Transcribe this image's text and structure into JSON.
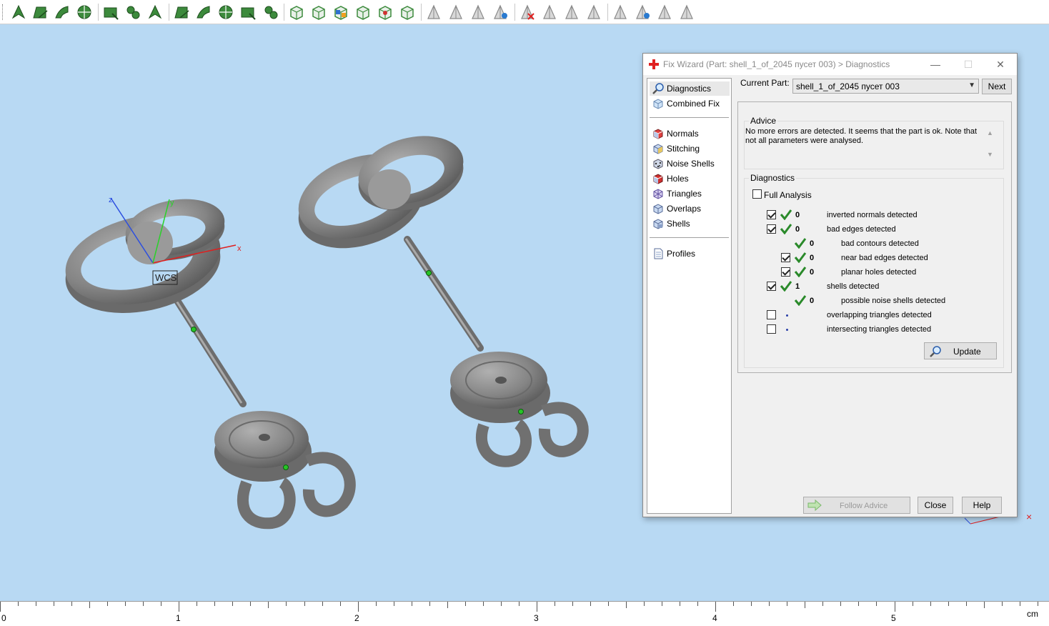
{
  "toolbar": {
    "tools": [
      {
        "name": "select-triangle-icon"
      },
      {
        "name": "select-area-icon"
      },
      {
        "name": "select-curve-icon"
      },
      {
        "name": "select-circle-icon"
      },
      {
        "name": "select-rect-icon"
      },
      {
        "name": "select-shell-icon"
      },
      {
        "name": "select-path-icon"
      },
      {
        "name": "select-plane-icon"
      },
      {
        "name": "select-edge-icon"
      },
      {
        "name": "select-multi-icon"
      },
      {
        "name": "select-wheel-icon"
      },
      {
        "name": "select-surface-icon"
      },
      {
        "name": "box-view-1-icon"
      },
      {
        "name": "box-view-2-icon"
      },
      {
        "name": "box-view-3-icon"
      },
      {
        "name": "box-view-4-icon"
      },
      {
        "name": "box-view-5-icon"
      },
      {
        "name": "box-view-6-icon"
      },
      {
        "name": "triangle-mark-1-icon"
      },
      {
        "name": "triangle-mark-2-icon"
      },
      {
        "name": "triangle-mark-3-icon"
      },
      {
        "name": "triangle-mark-4-icon"
      },
      {
        "name": "triangle-unmark-icon"
      },
      {
        "name": "triangle-mark-5-icon"
      },
      {
        "name": "triangle-mark-6-icon"
      },
      {
        "name": "triangle-mark-7-icon"
      },
      {
        "name": "shell-mark-1-icon"
      },
      {
        "name": "shell-mark-2-icon"
      },
      {
        "name": "shell-mark-3-icon"
      },
      {
        "name": "shell-mark-4-icon"
      }
    ]
  },
  "viewport": {
    "wcs_label": "WCS",
    "axis_x": "x",
    "axis_y": "y",
    "axis_z": "z",
    "close_mark": "×"
  },
  "ruler": {
    "labels": [
      "0",
      "1",
      "2",
      "3",
      "4",
      "5"
    ],
    "unit": "cm"
  },
  "dialog": {
    "title": "Fix Wizard (Part: shell_1_of_2045 пусет 003) > Diagnostics",
    "minimize": "—",
    "maximize": "☐",
    "close": "✕",
    "nav": {
      "diagnostics": "Diagnostics",
      "combined_fix": "Combined Fix",
      "normals": "Normals",
      "stitching": "Stitching",
      "noise_shells": "Noise Shells",
      "holes": "Holes",
      "triangles": "Triangles",
      "overlaps": "Overlaps",
      "shells": "Shells",
      "profiles": "Profiles"
    },
    "current_part_label": "Current Part:",
    "current_part_value": "shell_1_of_2045 пусет 003",
    "next_label": "Next",
    "advice_title": "Advice",
    "advice_text": "No more errors are detected. It seems that the part is ok. Note that not all parameters were analysed.",
    "diagnostics_title": "Diagnostics",
    "full_analysis": "Full Analysis",
    "rows": [
      {
        "count": "0",
        "text": "inverted normals detected"
      },
      {
        "count": "0",
        "text": "bad edges detected"
      },
      {
        "count": "0",
        "text": "bad contours detected"
      },
      {
        "count": "0",
        "text": "near bad edges detected"
      },
      {
        "count": "0",
        "text": "planar holes detected"
      },
      {
        "count": "1",
        "text": "shells detected"
      },
      {
        "count": "0",
        "text": "possible noise shells detected"
      },
      {
        "count": "",
        "text": "overlapping triangles detected"
      },
      {
        "count": "",
        "text": "intersecting triangles detected"
      }
    ],
    "update_label": "Update",
    "follow_advice_label": "Follow Advice",
    "close_label": "Close",
    "help_label": "Help"
  },
  "colors": {
    "viewport_bg": "#b8d9f3",
    "model_gray": "#7a7a7a",
    "check_green": "#2a8a2a",
    "icon_green": "#3c8a3c",
    "accent_red": "#e02020"
  }
}
